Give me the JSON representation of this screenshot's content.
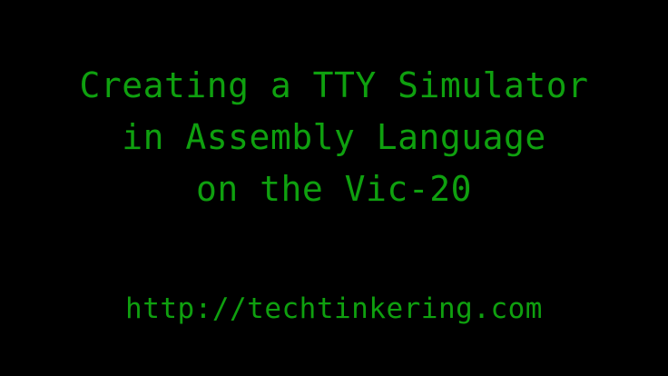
{
  "title": {
    "lines": [
      "Creating a TTY Simulator",
      "in Assembly Language",
      "on the Vic-20"
    ]
  },
  "url": "http://techtinkering.com",
  "colors": {
    "background": "#000000",
    "text": "#0fa00f"
  }
}
